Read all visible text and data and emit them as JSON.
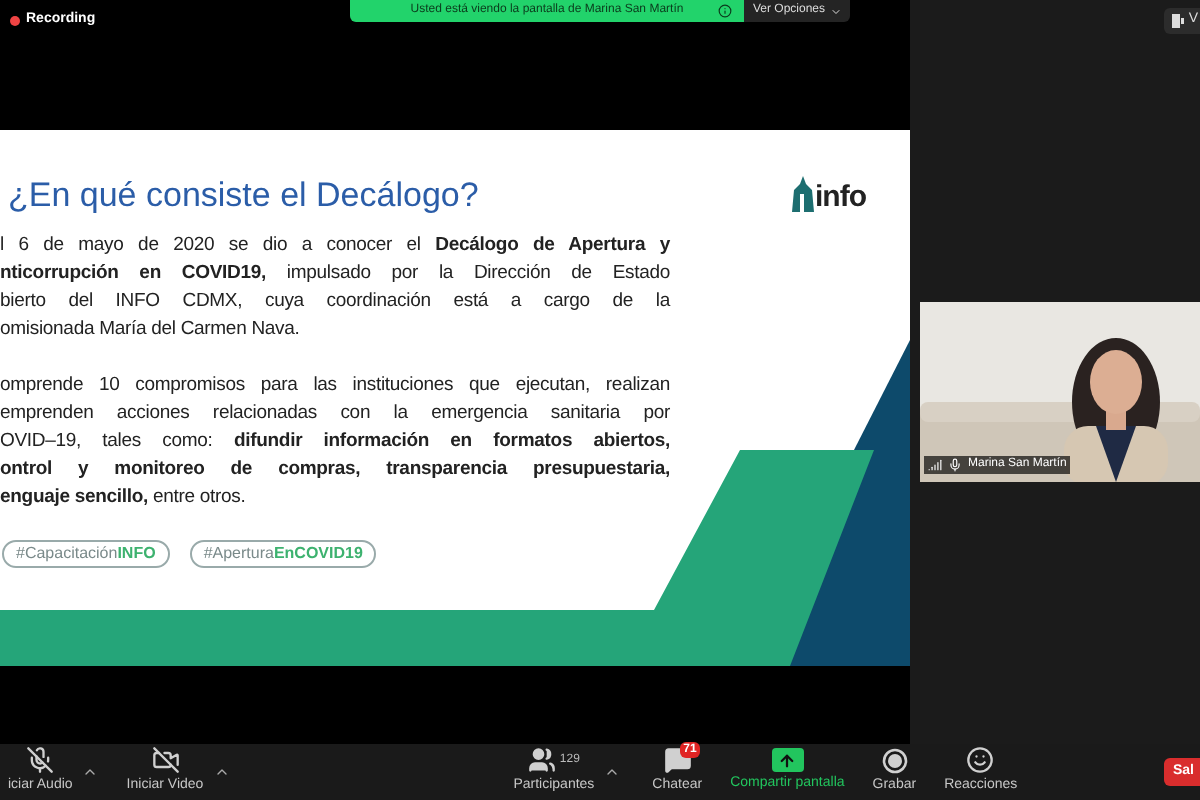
{
  "recording": {
    "label": "Recording"
  },
  "share_banner": {
    "message": "Usted está viendo la pantalla de Marina San Martín",
    "options_button": "Ver Opciones"
  },
  "view_button": {
    "label": "V"
  },
  "slide": {
    "title": "¿En qué consiste el Decálogo?",
    "logo": "info",
    "paragraphs": [
      [
        "l 6 de mayo de 2020 se dio a conocer el **Decálogo de Apertura y**",
        "**nticorrupción en COVID19,**  impulsado por la Dirección de Estado",
        "bierto del INFO CDMX, cuya coordinación está a cargo de la",
        "omisionada María del Carmen Nava."
      ],
      [
        "omprende 10 compromisos para las instituciones que ejecutan, realizan",
        "emprenden acciones relacionadas con la emergencia sanitaria por",
        "OVID–19, tales como: **difundir información en formatos abiertos,**",
        "**ontrol y monitoreo de compras, transparencia presupuestaria,**",
        "**enguaje sencillo,** entre otros."
      ]
    ],
    "hashtags": [
      {
        "text": "#Capacitación",
        "highlight": "INFO"
      },
      {
        "text": "#Apertura",
        "highlight": "EnCOVID19"
      }
    ]
  },
  "video": {
    "name": "Marina San Martín"
  },
  "toolbar": {
    "items": [
      {
        "kind": "audio",
        "label": "iciar Audio",
        "muted": true
      },
      {
        "kind": "video",
        "label": "Iniciar Video",
        "muted": true
      },
      {
        "kind": "participants",
        "label": "Participantes",
        "count": "129"
      },
      {
        "kind": "chat",
        "label": "Chatear",
        "badge": "71"
      },
      {
        "kind": "share",
        "label": "Compartir pantalla"
      },
      {
        "kind": "record",
        "label": "Grabar"
      },
      {
        "kind": "reactions",
        "label": "Reacciones"
      }
    ],
    "leave_button": "Sal"
  }
}
